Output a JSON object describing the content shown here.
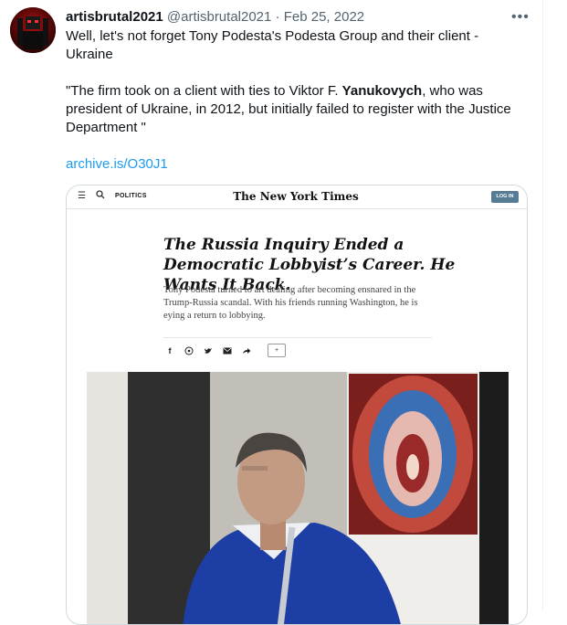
{
  "tweet": {
    "author_name": "artisbrutal2021",
    "author_handle": "@artisbrutal2021",
    "separator": "·",
    "date": "Feb 25, 2022",
    "line1": "Well, let's not forget Tony Podesta's Podesta Group and their client - Ukraine",
    "quote_before": "\"The firm took on a client with ties to Viktor F. ",
    "quote_bold": "Yanukovych",
    "quote_after": ", who was president of Ukraine, in 2012, but initially failed to register with the Justice Department \"",
    "link": "archive.is/O30J1",
    "more_icon": "ellipsis-icon",
    "link_color": "#1d9bf0"
  },
  "card": {
    "section": "POLITICS",
    "logo": "The New York Times",
    "login": "LOG IN",
    "headline": "The Russia Inquiry Ended a Democratic Lobbyist’s Career. He Wants It Back.",
    "summary": "Tony Podesta turned to art dealing after becoming ensnared in the Trump-Russia scandal. With his friends running Washington, he is eying a return to lobbying.",
    "share_icons": [
      "facebook-icon",
      "whatsapp-icon",
      "twitter-icon",
      "email-icon",
      "share-arrow-icon"
    ],
    "comment_icon": "comment-icon",
    "login_color": "#567b95"
  }
}
